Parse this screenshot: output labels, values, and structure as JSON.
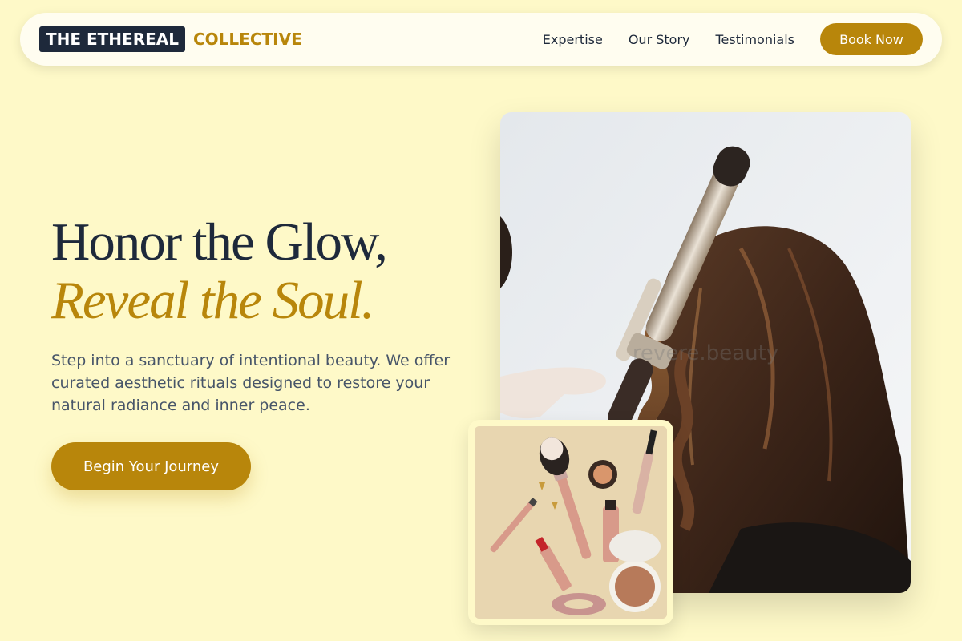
{
  "brand": {
    "name_dark": "THE ETHEREAL",
    "name_gold": "COLLECTIVE"
  },
  "nav": {
    "links": [
      "Expertise",
      "Our Story",
      "Testimonials"
    ],
    "cta": "Book Now"
  },
  "hero": {
    "title_line1": "Honor the Glow,",
    "title_line2": "Reveal the Soul.",
    "description": "Step into a sanctuary of intentional beauty. We offer curated aesthetic rituals designed to restore your natural radiance and inner peace.",
    "cta": "Begin Your Journey"
  },
  "images": {
    "main_alt": "Stylist curling long brown hair with a curling iron",
    "main_watermark": "revere.beauty",
    "thumb_alt": "Flat lay of makeup brushes, lipstick, mascara and compact powder"
  },
  "colors": {
    "accent": "#b8860b",
    "dark": "#1e293b",
    "background": "#fef9c8"
  }
}
